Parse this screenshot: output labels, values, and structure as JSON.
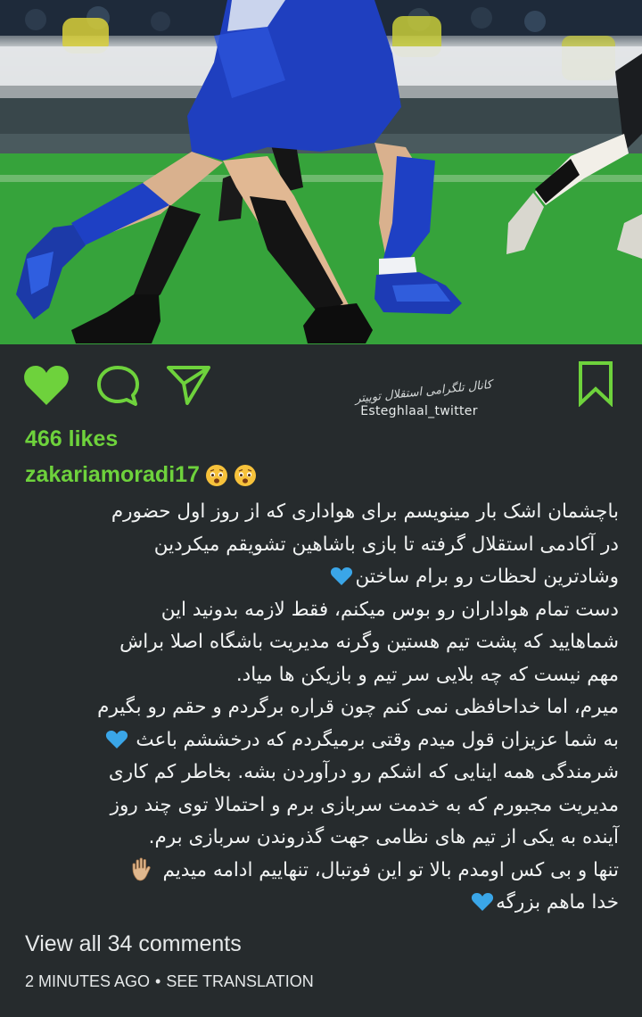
{
  "post": {
    "likes": "466 likes",
    "username": "zakariamoradi17",
    "watermark": {
      "script_text": "کانال تلگرامی استقلال توییتر",
      "handle": "Esteghlaal_twitter"
    },
    "caption_lines": [
      "باچشمان اشک بار مینویسم برای هواداری که از روز اول حضورم",
      "در آکادمی استقلال گرفته تا بازی باشاهین تشویقم میکردین",
      "وشادترین لحظات رو برام ساختن",
      "دست تمام هواداران رو بوس میکنم، فقط لازمه بدونید این",
      "شماهایید که پشت تیم هستین وگرنه مدیریت باشگاه اصلا براش",
      "مهم نیست که چه بلایی سر تیم و بازیکن ها میاد.",
      "میرم، اما خداحافظی نمی کنم چون قراره برگردم و حقم رو بگیرم",
      "به شما عزیزان قول میدم وقتی برمیگردم که درخششم باعث",
      "شرمندگی همه اینایی که اشکم رو درآوردن بشه. بخاطر کم کاری",
      "مدیریت مجبورم که به خدمت سربازی برم و احتمالا توی چند روز",
      "آینده به یکی از تیم های نظامی جهت گذروندن سربازی برم.",
      "تنها و بی کس اومدم بالا تو این فوتبال، تنهاییم ادامه میدیم",
      "خدا ماهم بزرگه"
    ],
    "view_comments": "View all 34 comments",
    "timestamp": "2 MINUTES AGO",
    "separator": "•",
    "see_translation": "SEE TRANSLATION"
  },
  "icons": {
    "like": "heart-icon",
    "comment": "comment-bubble-icon",
    "share": "paper-plane-icon",
    "save": "bookmark-icon",
    "emoji": "sad-face-emoji",
    "blue_heart": "blue-heart-emoji",
    "hand": "raised-hand-emoji"
  },
  "colors": {
    "background": "#262b2d",
    "accent_green": "#6ed23c",
    "text": "#f1f3f3",
    "blue_heart": "#3aa6e8"
  }
}
